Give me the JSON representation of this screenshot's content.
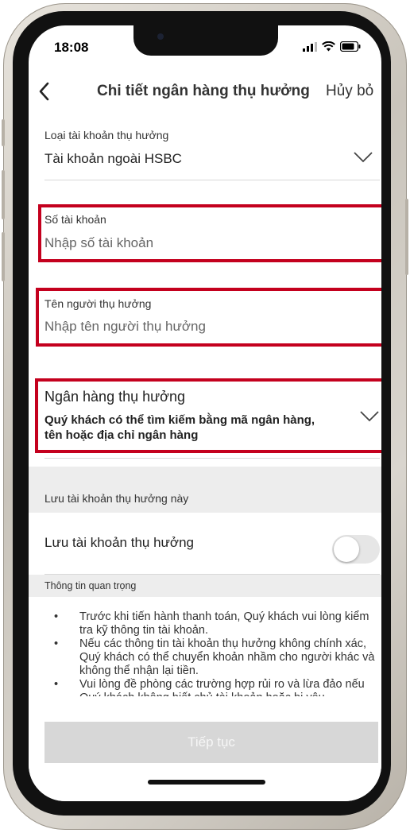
{
  "status_bar": {
    "time": "18:08"
  },
  "nav": {
    "title": "Chi tiết ngân hàng thụ hưởng",
    "cancel_label": "Hủy bỏ"
  },
  "account_type": {
    "label": "Loại tài khoản thụ hưởng",
    "value": "Tài khoản ngoài HSBC"
  },
  "account_number": {
    "label": "Số tài khoản",
    "placeholder": "Nhập số tài khoản"
  },
  "beneficiary_name": {
    "label": "Tên người thụ hưởng",
    "placeholder": "Nhập tên người thụ hưởng"
  },
  "beneficiary_bank": {
    "label": "Ngân hàng thụ hưởng",
    "hint_line1": "Quý khách có thể tìm kiếm bằng mã ngân hàng,",
    "hint_line2": "tên hoặc địa chỉ ngân hàng"
  },
  "save_section": {
    "title": "Lưu tài khoản thụ hưởng này",
    "toggle_label": "Lưu tài khoản thụ hưởng",
    "toggle_on": false
  },
  "important_info": {
    "title": "Thông tin quan trọng",
    "items": [
      "Trước khi tiến hành thanh toán, Quý khách vui lòng kiểm tra kỹ thông tin tài khoản.",
      "Nếu các thông tin tài khoản thụ hưởng không chính xác, Quý khách có thể chuyển khoản nhầm cho người khác và không thể nhận lại tiền.",
      "Vui lòng đề phòng các trường hợp rủi ro và lừa đảo nếu Quý khách không biết chủ tài khoản hoặc bị yêu"
    ]
  },
  "continue_button": {
    "label": "Tiếp tục",
    "enabled": false
  },
  "colors": {
    "highlight": "#c4001e",
    "button_disabled": "#d7d7d7",
    "section_bg": "#ededed"
  }
}
